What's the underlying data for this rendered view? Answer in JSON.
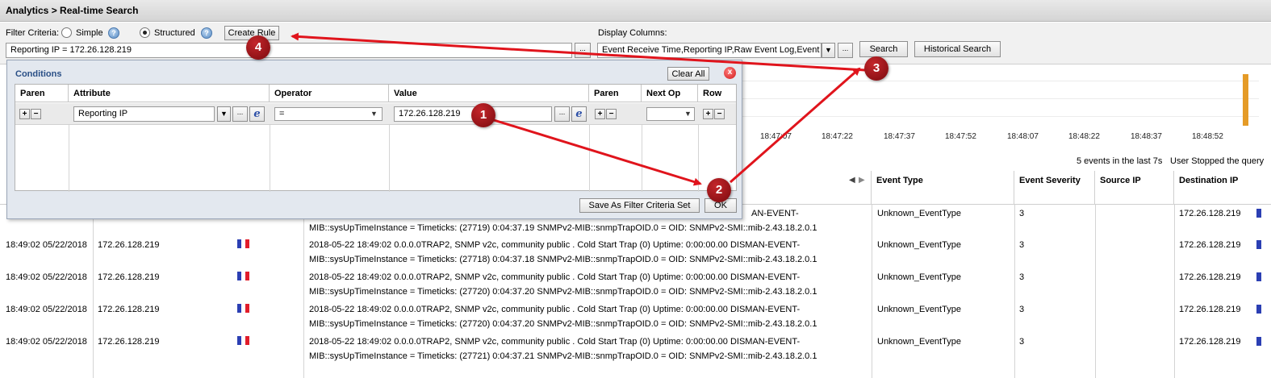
{
  "window": {
    "breadcrumb": "Analytics > Real-time Search"
  },
  "filter": {
    "criteria_label": "Filter Criteria:",
    "simple_label": "Simple",
    "structured_label": "Structured",
    "selected_mode": "Structured",
    "create_rule_label": "Create Rule",
    "query_value": "Reporting IP = 172.26.128.219",
    "display_columns_label": "Display Columns:",
    "display_columns_value": "Event Receive Time,Reporting IP,Raw Event Log,Event",
    "search_label": "Search",
    "historical_search_label": "Historical Search",
    "ellipsis": "..."
  },
  "timeline": {
    "ticks": [
      "18:47:07",
      "18:47:22",
      "18:47:37",
      "18:47:52",
      "18:48:07",
      "18:48:22",
      "18:48:37",
      "18:48:52"
    ],
    "bar_color": "#e59b27"
  },
  "status": {
    "events_text": "5 events in the last 7s",
    "query_state": "User Stopped the query"
  },
  "results": {
    "columns": [
      "Event Type",
      "Event Severity",
      "Source IP",
      "Destination IP"
    ],
    "partial_first_line": "AN-EVENT-",
    "rows": [
      {
        "time": "",
        "reporting_ip": "",
        "raw_line1": "",
        "raw_line2": "MIB::sysUpTimeInstance = Timeticks: (27719) 0:04:37.19   SNMPv2-MIB::snmpTrapOID.0 = OID: SNMPv2-SMI::mib-2.43.18.2.0.1",
        "event_type": "Unknown_EventType",
        "severity": "3",
        "source_ip": "",
        "dest_ip": "172.26.128.219"
      },
      {
        "time": "18:49:02 05/22/2018",
        "reporting_ip": "172.26.128.219",
        "raw_line1": "2018-05-22 18:49:02 0.0.0.0TRAP2, SNMP v2c, community public   . Cold Start Trap (0) Uptime: 0:00:00.00     DISMAN-EVENT-",
        "raw_line2": "MIB::sysUpTimeInstance = Timeticks: (27718) 0:04:37.18   SNMPv2-MIB::snmpTrapOID.0 = OID: SNMPv2-SMI::mib-2.43.18.2.0.1",
        "event_type": "Unknown_EventType",
        "severity": "3",
        "source_ip": "",
        "dest_ip": "172.26.128.219"
      },
      {
        "time": "18:49:02 05/22/2018",
        "reporting_ip": "172.26.128.219",
        "raw_line1": "2018-05-22 18:49:02 0.0.0.0TRAP2, SNMP v2c, community public   . Cold Start Trap (0) Uptime: 0:00:00.00     DISMAN-EVENT-",
        "raw_line2": "MIB::sysUpTimeInstance = Timeticks: (27720) 0:04:37.20   SNMPv2-MIB::snmpTrapOID.0 = OID: SNMPv2-SMI::mib-2.43.18.2.0.1",
        "event_type": "Unknown_EventType",
        "severity": "3",
        "source_ip": "",
        "dest_ip": "172.26.128.219"
      },
      {
        "time": "18:49:02 05/22/2018",
        "reporting_ip": "172.26.128.219",
        "raw_line1": "2018-05-22 18:49:02 0.0.0.0TRAP2, SNMP v2c, community public   . Cold Start Trap (0) Uptime: 0:00:00.00     DISMAN-EVENT-",
        "raw_line2": "MIB::sysUpTimeInstance = Timeticks: (27720) 0:04:37.20   SNMPv2-MIB::snmpTrapOID.0 = OID: SNMPv2-SMI::mib-2.43.18.2.0.1",
        "event_type": "Unknown_EventType",
        "severity": "3",
        "source_ip": "",
        "dest_ip": "172.26.128.219"
      },
      {
        "time": "18:49:02 05/22/2018",
        "reporting_ip": "172.26.128.219",
        "raw_line1": "2018-05-22 18:49:02 0.0.0.0TRAP2, SNMP v2c, community public   . Cold Start Trap (0) Uptime: 0:00:00.00     DISMAN-EVENT-",
        "raw_line2": "MIB::sysUpTimeInstance = Timeticks: (27721) 0:04:37.21   SNMPv2-MIB::snmpTrapOID.0 = OID: SNMPv2-SMI::mib-2.43.18.2.0.1",
        "event_type": "Unknown_EventType",
        "severity": "3",
        "source_ip": "",
        "dest_ip": "172.26.128.219"
      }
    ]
  },
  "conditions": {
    "title": "Conditions",
    "clear_all_label": "Clear All",
    "columns": [
      "Paren",
      "Attribute",
      "Operator",
      "Value",
      "Paren",
      "Next Op",
      "Row"
    ],
    "row": {
      "attribute": "Reporting IP",
      "operator": "=",
      "value": "172.26.128.219",
      "next_op": ""
    },
    "save_label": "Save As Filter Criteria Set",
    "ok_label": "OK"
  },
  "annotations": {
    "markers": [
      "1",
      "2",
      "3",
      "4"
    ],
    "arrow_color": "#e0141c",
    "marker_color": "#a01218"
  },
  "icons": {
    "help": "?",
    "close": "x",
    "expression": "e",
    "plus": "+",
    "minus": "−",
    "dropdown": "▼",
    "nav_left": "◀",
    "nav_right": "▶"
  }
}
